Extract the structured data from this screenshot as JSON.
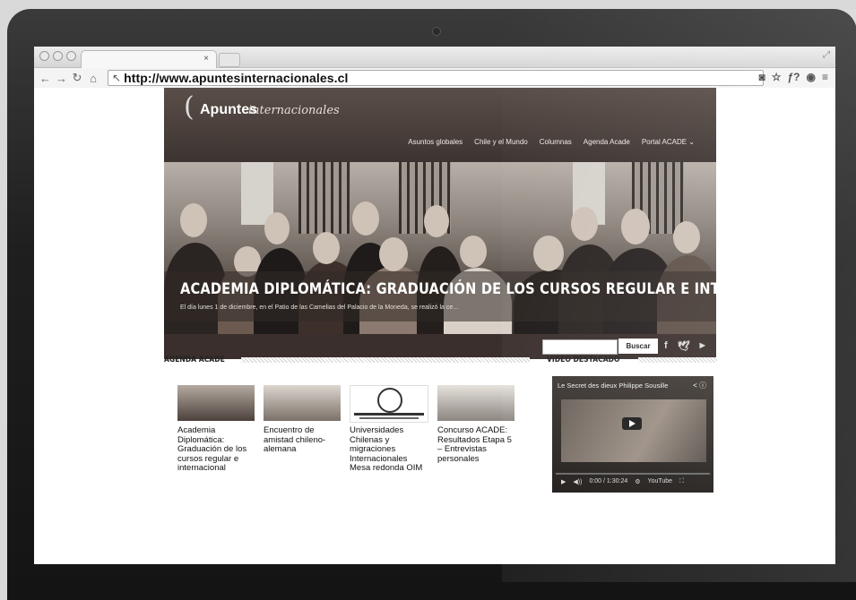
{
  "browser": {
    "url": "http://www.apuntesinternacionales.cl",
    "tab_close": "×"
  },
  "site": {
    "logo_main": "Apuntes",
    "logo_sub": "internacionales",
    "nav": [
      "Asuntos globales",
      "Chile y el Mundo",
      "Columnas",
      "Agenda Acade",
      "Portal ACADE ⌄"
    ],
    "hero_title": "ACADEMIA DIPLOMÁTICA: GRADUACIÓN DE LOS CURSOS REGULAR E INTERNACIONAL",
    "hero_desc": "El día lunes 1 de diciembre, en el Patio de las Camelias del Palacio de la Moneda, se realizó la ce...",
    "search_button": "Buscar",
    "social": [
      "f",
      "t",
      "yt"
    ]
  },
  "agenda": {
    "heading": "AGENDA ACADE",
    "items": [
      {
        "title": "Academia Diplomática: Graduación de los cursos regular e internacional"
      },
      {
        "title": "Encuentro de amistad chileno-alemana"
      },
      {
        "title": "Universidades Chilenas y migraciones Internacionales Mesa redonda OIM"
      },
      {
        "title": "Concurso ACADE: Resultados Etapa 5 – Entrevistas personales"
      }
    ]
  },
  "video": {
    "heading": "VIDEO DESTACADO",
    "title": "Le Secret des dieux Philippe Sousille",
    "time": "0:00 / 1:30:24"
  }
}
